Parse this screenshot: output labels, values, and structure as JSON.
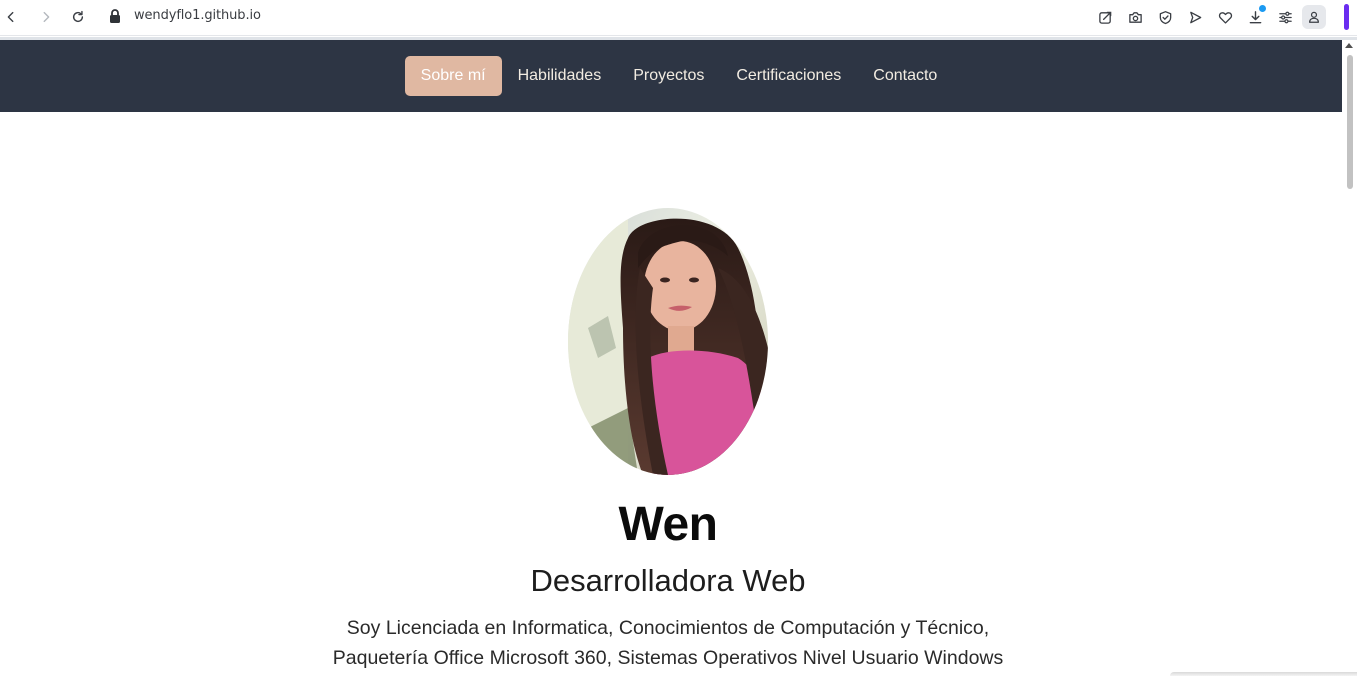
{
  "browser": {
    "url": "wendyflo1.github.io",
    "icons": {
      "back": "back-arrow-icon",
      "forward": "forward-arrow-icon",
      "reload": "reload-icon",
      "lock": "lock-icon",
      "edit": "edit-share-icon",
      "camera": "camera-icon",
      "shield": "shield-check-icon",
      "send": "send-icon",
      "heart": "heart-icon",
      "download": "download-icon",
      "menu": "easy-setup-icon",
      "profile": "profile-icon"
    },
    "accent_color": "#6a2cf0",
    "download_badge_color": "#1b9af2"
  },
  "site_nav": {
    "background": "#2d3544",
    "active_color": "#e0b8a2",
    "items": [
      {
        "label": "Sobre mí",
        "active": true
      },
      {
        "label": "Habilidades",
        "active": false
      },
      {
        "label": "Proyectos",
        "active": false
      },
      {
        "label": "Certificaciones",
        "active": false
      },
      {
        "label": "Contacto",
        "active": false
      }
    ]
  },
  "hero": {
    "photo": "profile-photo",
    "name": "Wen",
    "role": "Desarrolladora Web",
    "description_lines": [
      "Soy Licenciada en Informatica, Conocimientos de Computación y Técnico,",
      "Paquetería Office Microsoft 360, Sistemas Operativos Nivel Usuario Windows"
    ]
  }
}
